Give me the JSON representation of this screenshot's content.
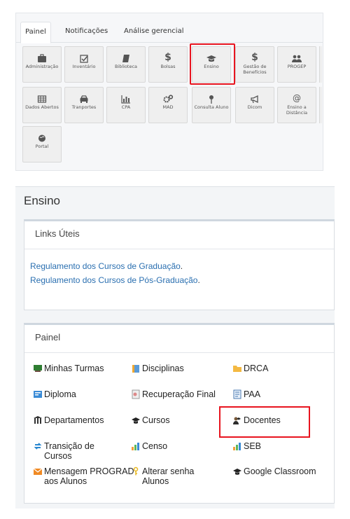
{
  "tabs": [
    "Painel",
    "Notificações",
    "Análise gerencial"
  ],
  "tiles_row1": [
    {
      "label": "Administração",
      "icon": "briefcase-icon"
    },
    {
      "label": "Inventário",
      "icon": "checkbox-icon"
    },
    {
      "label": "Biblioteca",
      "icon": "book-icon"
    },
    {
      "label": "Bolsas",
      "icon": "dollar-icon"
    },
    {
      "label": "Ensino",
      "icon": "graduation-cap-icon"
    },
    {
      "label": "Gestão de Benefícios",
      "icon": "dollar-icon"
    },
    {
      "label": "PROGEP",
      "icon": "users-icon"
    }
  ],
  "tiles_row2": [
    {
      "label": "Dados Abertos",
      "icon": "table-icon"
    },
    {
      "label": "Tranportes",
      "icon": "car-icon"
    },
    {
      "label": "CPA",
      "icon": "bar-chart-icon"
    },
    {
      "label": "MAD",
      "icon": "gears-icon"
    },
    {
      "label": "Consulta Aluno",
      "icon": "pin-icon"
    },
    {
      "label": "Dicom",
      "icon": "bullhorn-icon"
    },
    {
      "label": "Ensino a Distância",
      "icon": "at-icon"
    }
  ],
  "tiles_row3": [
    {
      "label": "Portal",
      "icon": "globe-icon"
    }
  ],
  "ensino": {
    "title": "Ensino",
    "links_header": "Links Úteis",
    "link1": "Regulamento dos Cursos de Graduação",
    "link2": "Regulamento dos Cursos de Pós-Graduação",
    "panel_header": "Painel",
    "items": [
      {
        "label": "Minhas Turmas",
        "icon": "classroom-icon"
      },
      {
        "label": "Disciplinas",
        "icon": "disciplines-icon"
      },
      {
        "label": "DRCA",
        "icon": "folder-icon"
      },
      {
        "label": "Diploma",
        "icon": "diploma-icon"
      },
      {
        "label": "Recuperação Final",
        "icon": "recovery-icon"
      },
      {
        "label": "PAA",
        "icon": "document-icon"
      },
      {
        "label": "Departamentos",
        "icon": "departments-icon"
      },
      {
        "label": "Cursos",
        "icon": "graduation-cap-icon"
      },
      {
        "label": "Docentes",
        "icon": "teachers-icon"
      },
      {
        "label": "Transição de Cursos",
        "icon": "transition-icon"
      },
      {
        "label": "Censo",
        "icon": "census-chart-icon"
      },
      {
        "label": "SEB",
        "icon": "seb-chart-icon"
      },
      {
        "label": "Mensagem PROGRAD aos Alunos",
        "icon": "envelope-icon"
      },
      {
        "label": "Alterar senha Alunos",
        "icon": "key-icon"
      },
      {
        "label": "Google Classroom",
        "icon": "graduation-cap-icon"
      }
    ]
  }
}
